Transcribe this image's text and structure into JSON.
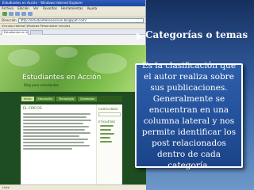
{
  "slide": {
    "title": "Categorías o temas",
    "explanation": "Es la clasificación que el autor realiza sobre sus publicaciones. Generalmente se encuentran en una columna lateral y nos permite identificar los post relacionados dentro de cada categoría."
  },
  "browser": {
    "window_title": "Estudiantes en Acción - Windows Internet Explorer",
    "menu": [
      "Archivo",
      "Edición",
      "Ver",
      "Favoritos",
      "Herramientas",
      "Ayuda"
    ],
    "address_label": "Dirección",
    "address": "http://estudiantesenaccion.blogspot.com/",
    "links_bar": "Vínculos  Hotmail  Windows  Personalizar vínculos",
    "tab_label": "Estudiantes en Acción",
    "status": "Listo"
  },
  "blog": {
    "title": "Estudiantes en Acción",
    "subtitle": "Blog para estudiantes",
    "nav": [
      "Inicio",
      "Educación",
      "Tecnología",
      "Contactos"
    ],
    "post_title": "EL CIRCOS",
    "sidebar_heading": "CATEGORÍAS",
    "sidebar_tags": "ETIQUETAS"
  },
  "colors": {
    "slide_background": "#2d5596",
    "box_background": "#23509a",
    "blog_green": "#5f9e3a"
  }
}
